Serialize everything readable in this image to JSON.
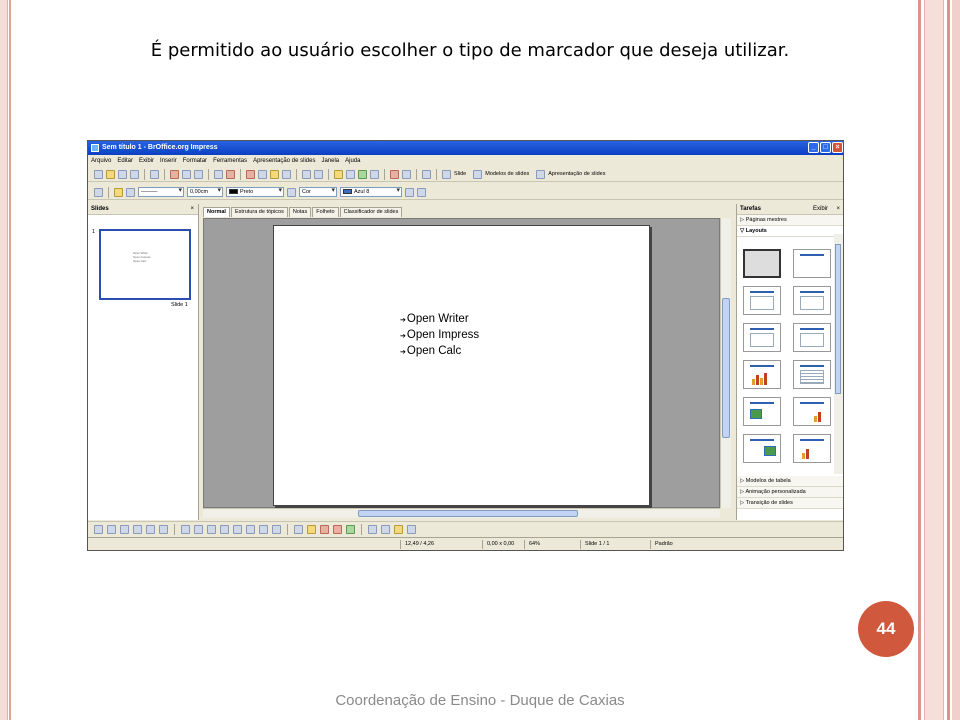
{
  "slide": {
    "title": "É permitido ao usuário escolher o tipo de marcador que deseja utilizar.",
    "page_number": "44",
    "footer": "Coordenação de Ensino - Duque de Caxias"
  },
  "app": {
    "window_title": "Sem título 1 - BrOffice.org Impress",
    "window_buttons": [
      "_",
      "□",
      "×"
    ],
    "menu": [
      "Arquivo",
      "Editar",
      "Exibir",
      "Inserir",
      "Formatar",
      "Ferramentas",
      "Apresentação de slides",
      "Janela",
      "Ajuda"
    ],
    "toolbar1": {
      "slide_label": "Slide",
      "templates_label": "Modelos de slides",
      "presentation_label": "Apresentação de slides"
    },
    "toolbar2": {
      "line_width": "0,00cm",
      "line_color": "Preto",
      "fill_type": "Cor",
      "fill_color": "Azul 8"
    },
    "slides_pane": {
      "header": "Slides",
      "close": "×",
      "slide_number": "1",
      "slide_caption": "Slide 1"
    },
    "tabs": [
      "Normal",
      "Estrutura de tópicos",
      "Notas",
      "Folheto",
      "Classificador de slides"
    ],
    "active_tab": "Normal",
    "bullets": [
      "Open Writer",
      "Open Impress",
      "Open Calc"
    ],
    "bullet_symbol": "➔",
    "tasks_pane": {
      "header": "Tarefas",
      "view": "Exibir",
      "close": "×",
      "master_pages": "Páginas mestres",
      "layouts": "Layouts",
      "table_design": "Modelos de tabela",
      "custom_animation": "Animação personalizada",
      "slide_transition": "Transição de slides"
    },
    "status": {
      "position": "12,49 / 4,26",
      "size": "0,00 x 0,00",
      "zoom": "64%",
      "slide": "Slide 1 / 1",
      "layout": "Padrão"
    }
  },
  "colors": {
    "accent_circle": "#d0583d",
    "title_bar": "#0a3fc4",
    "thumb_border": "#2b4fb0"
  }
}
